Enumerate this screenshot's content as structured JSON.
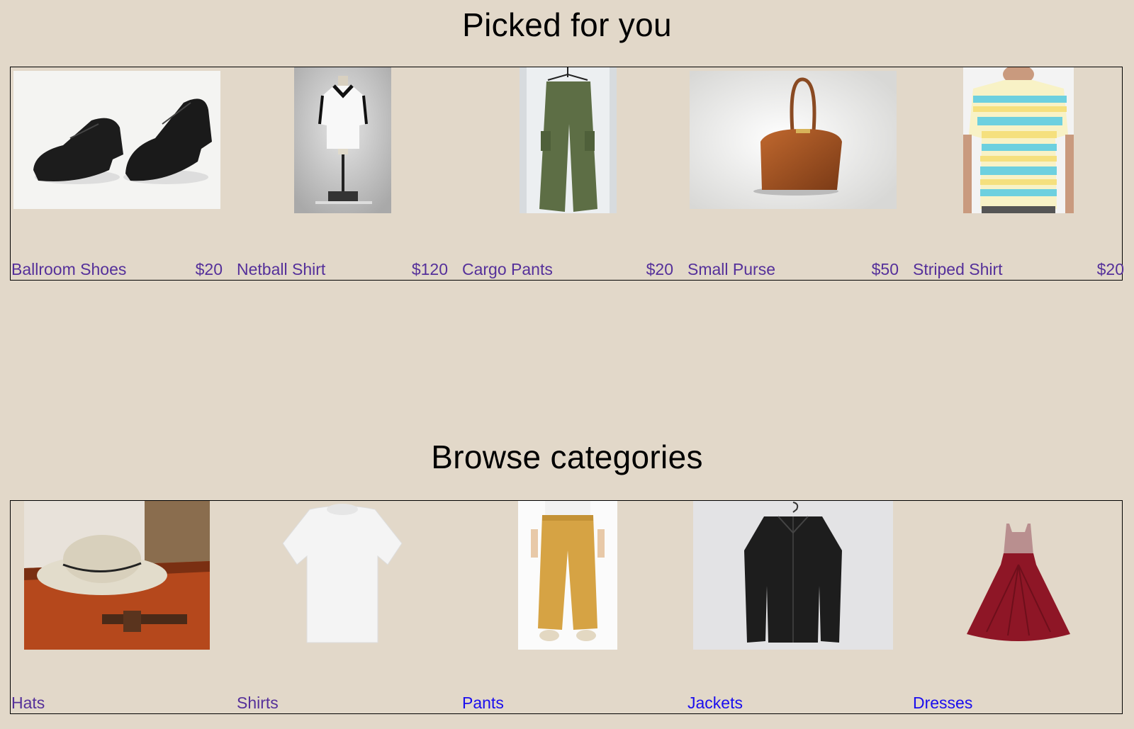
{
  "picked": {
    "title": "Picked for you",
    "items": [
      {
        "name": "Ballroom Shoes",
        "price": "$20",
        "image": "black-leather-shoes"
      },
      {
        "name": "Netball Shirt",
        "price": "$120",
        "image": "white-shirt-on-mannequin"
      },
      {
        "name": "Cargo Pants",
        "price": "$20",
        "image": "green-cargo-pants-on-hanger"
      },
      {
        "name": "Small Purse",
        "price": "$50",
        "image": "brown-croc-handbag"
      },
      {
        "name": "Striped Shirt",
        "price": "$20",
        "image": "striped-polo-shirt"
      }
    ]
  },
  "browse": {
    "title": "Browse categories",
    "items": [
      {
        "name": "Hats",
        "image": "straw-hat-on-trunk"
      },
      {
        "name": "Shirts",
        "image": "white-tshirt"
      },
      {
        "name": "Pants",
        "image": "mustard-pants"
      },
      {
        "name": "Jackets",
        "image": "black-leather-jacket"
      },
      {
        "name": "Dresses",
        "image": "red-ball-gown"
      }
    ]
  },
  "colors": {
    "background": "#e2d8c9",
    "visited_link": "#55309a",
    "link": "#1a0dee"
  }
}
